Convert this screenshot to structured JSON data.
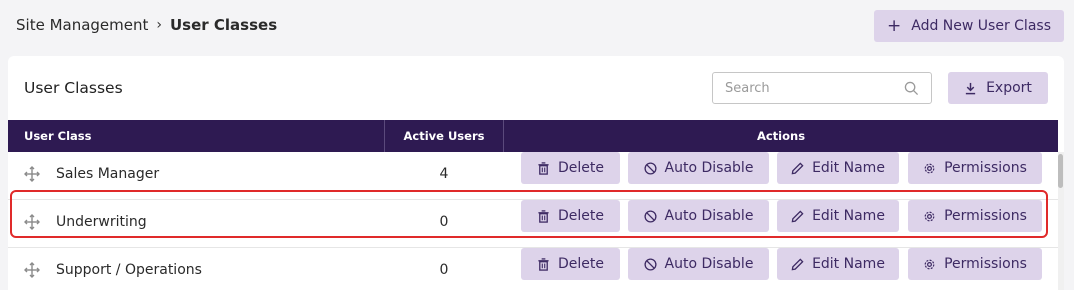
{
  "breadcrumb": {
    "parent": "Site Management",
    "separator": "›",
    "current": "User Classes"
  },
  "header": {
    "add_button_label": "Add New User Class",
    "add_icon": "+"
  },
  "card": {
    "title": "User Classes",
    "search_placeholder": "Search",
    "export_label": "Export"
  },
  "table": {
    "columns": [
      "User Class",
      "Active Users",
      "Actions"
    ],
    "actions": {
      "delete": "Delete",
      "auto_disable": "Auto Disable",
      "edit_name": "Edit Name",
      "permissions": "Permissions"
    },
    "rows": [
      {
        "name": "Sales Manager",
        "active_users": "4"
      },
      {
        "name": "Underwriting",
        "active_users": "0"
      },
      {
        "name": "Support / Operations",
        "active_users": "0"
      }
    ]
  },
  "colors": {
    "header_bg": "#2e1a52",
    "button_bg": "#ddd3ea",
    "button_text": "#3d2a63",
    "highlight": "#e02a2a"
  }
}
